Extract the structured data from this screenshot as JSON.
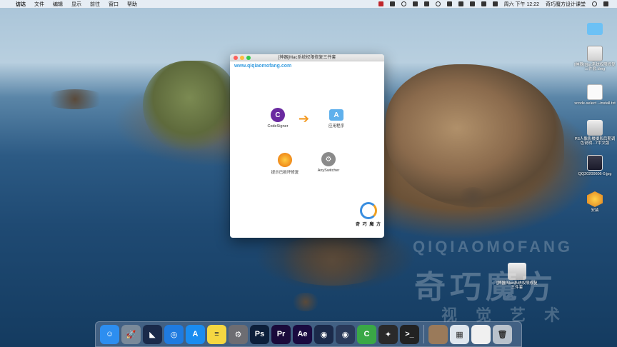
{
  "menubar": {
    "apple": "",
    "items": [
      "访达",
      "文件",
      "编辑",
      "显示",
      "前往",
      "窗口",
      "帮助"
    ],
    "clock": "周六 下午 12:22",
    "user": "奇巧魔方设计课堂"
  },
  "window": {
    "title": "[神器]Mac系统权限修复三件套",
    "url": "www.qiqiaomofang.com",
    "items": [
      {
        "label": "CodeSigner",
        "icon": "codesigner-icon",
        "glyph": "C"
      },
      {
        "label": "应用程序",
        "icon": "applications-folder-icon",
        "glyph": "A"
      },
      {
        "label": "提示已损坏修复",
        "icon": "hint-repair-icon",
        "glyph": ""
      },
      {
        "label": "AnySwitcher",
        "icon": "anyswitcher-icon",
        "glyph": "⚙"
      }
    ],
    "arrow": "➔",
    "logo_text": "奇 巧 魔 方"
  },
  "desktop": {
    "icons": [
      {
        "label": "",
        "icon": "folder-icon"
      },
      {
        "label": "[神器]Mac系统权限修复三件套.dmg",
        "icon": "dmg-file-icon"
      },
      {
        "label": "xcode-select --install.txt",
        "icon": "txt-file-icon"
      },
      {
        "label": "PS人像影楼摄影后期调色说明...7中文版",
        "icon": "disk-image-icon"
      },
      {
        "label": "QQ20200606-0.jpg",
        "icon": "jpg-file-icon"
      },
      {
        "label": "安装",
        "icon": "installer-icon"
      },
      {
        "label": "[神器]Mac系统权限修复三件套",
        "icon": "mounted-disk-icon"
      }
    ]
  },
  "watermark": {
    "line1": "QIQIAOMOFANG",
    "line2": "奇巧魔方",
    "line3": "视觉艺术"
  },
  "dock": {
    "apps": [
      {
        "name": "finder-icon",
        "glyph": "☺",
        "color": "#2d8ef0"
      },
      {
        "name": "launchpad-icon",
        "glyph": "🚀",
        "color": "#7a8a9a"
      },
      {
        "name": "cat-app-icon",
        "glyph": "◣",
        "color": "#1a2a4a"
      },
      {
        "name": "safari-icon",
        "glyph": "◎",
        "color": "#1f7be0"
      },
      {
        "name": "app-store-icon",
        "glyph": "A",
        "color": "#1a8cf0"
      },
      {
        "name": "notes-icon",
        "glyph": "≡",
        "color": "#f5d742"
      },
      {
        "name": "system-preferences-icon",
        "glyph": "⚙",
        "color": "#6d6d72"
      },
      {
        "name": "photoshop-icon",
        "glyph": "Ps",
        "color": "#0c1f3a"
      },
      {
        "name": "premiere-icon",
        "glyph": "Pr",
        "color": "#1a0a3a"
      },
      {
        "name": "after-effects-icon",
        "glyph": "Ae",
        "color": "#1a0a40"
      },
      {
        "name": "cinema4d-icon",
        "glyph": "◉",
        "color": "#1b2a4a"
      },
      {
        "name": "cinema4d-lite-icon",
        "glyph": "◉",
        "color": "#2a3a5a"
      },
      {
        "name": "camtasia-icon",
        "glyph": "C",
        "color": "#3aa846"
      },
      {
        "name": "final-cut-icon",
        "glyph": "✦",
        "color": "#2a2a2a"
      },
      {
        "name": "terminal-icon",
        "glyph": ">_",
        "color": "#222222"
      }
    ],
    "docs": [
      {
        "name": "photo-stack-icon",
        "glyph": "",
        "color": "#9a7a5a"
      },
      {
        "name": "preview-stack-icon",
        "glyph": "▦",
        "color": "#dfe6ee"
      },
      {
        "name": "document-stack-icon",
        "glyph": "",
        "color": "#f0f0f0"
      },
      {
        "name": "trash-icon",
        "glyph": "🗑",
        "color": "#b9c2cc"
      }
    ]
  }
}
